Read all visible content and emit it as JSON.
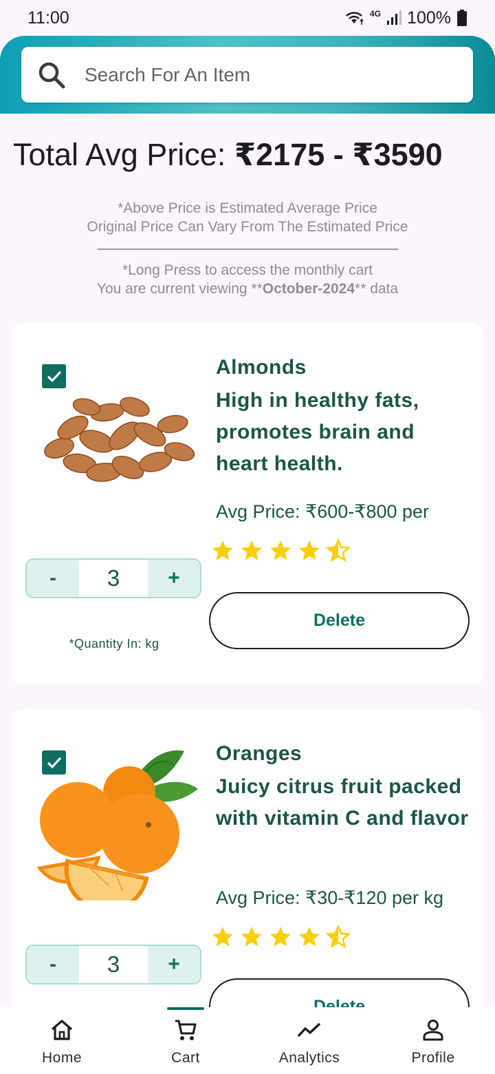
{
  "status_bar": {
    "time": "11:00",
    "network": "4G",
    "battery": "100%"
  },
  "search": {
    "placeholder": "Search For An Item"
  },
  "summary": {
    "total_label": "Total Avg Price: ",
    "total_value": "₹2175 - ₹3590",
    "note_line1": "*Above Price is Estimated Average Price",
    "note_line2": "Original Price Can Vary From The Estimated Price",
    "note_line3": "*Long Press to access the monthly cart",
    "note_line4_prefix": "You are current viewing **",
    "note_line4_month": "October-2024",
    "note_line4_suffix": "** data"
  },
  "items": [
    {
      "name": "Almonds",
      "description": "High in healthy fats, promotes brain and heart health.",
      "price": "Avg Price: ₹600-₹800 per",
      "rating": 4.5,
      "checked": true,
      "minus_label": "-",
      "quantity": "3",
      "plus_label": "+",
      "quantity_note": "*Quantity In: kg",
      "delete_label": "Delete"
    },
    {
      "name": "Oranges",
      "description": "Juicy citrus fruit packed with vitamin C and flavor",
      "price": "Avg Price: ₹30-₹120 per kg",
      "rating": 4.5,
      "checked": true,
      "minus_label": "-",
      "quantity": "3",
      "plus_label": "+",
      "delete_label": "Delete"
    }
  ],
  "bottom_nav": {
    "items": [
      {
        "label": "Home",
        "icon": "home-icon"
      },
      {
        "label": "Cart",
        "icon": "cart-icon",
        "active": true
      },
      {
        "label": "Analytics",
        "icon": "analytics-icon"
      },
      {
        "label": "Profile",
        "icon": "profile-icon"
      }
    ]
  },
  "colors": {
    "accent": "#0f6e61",
    "header_gradient_start": "#0b9fb3",
    "header_gradient_end": "#0a8c95",
    "star": "#f9cf0b",
    "background": "#fbf6fc"
  }
}
